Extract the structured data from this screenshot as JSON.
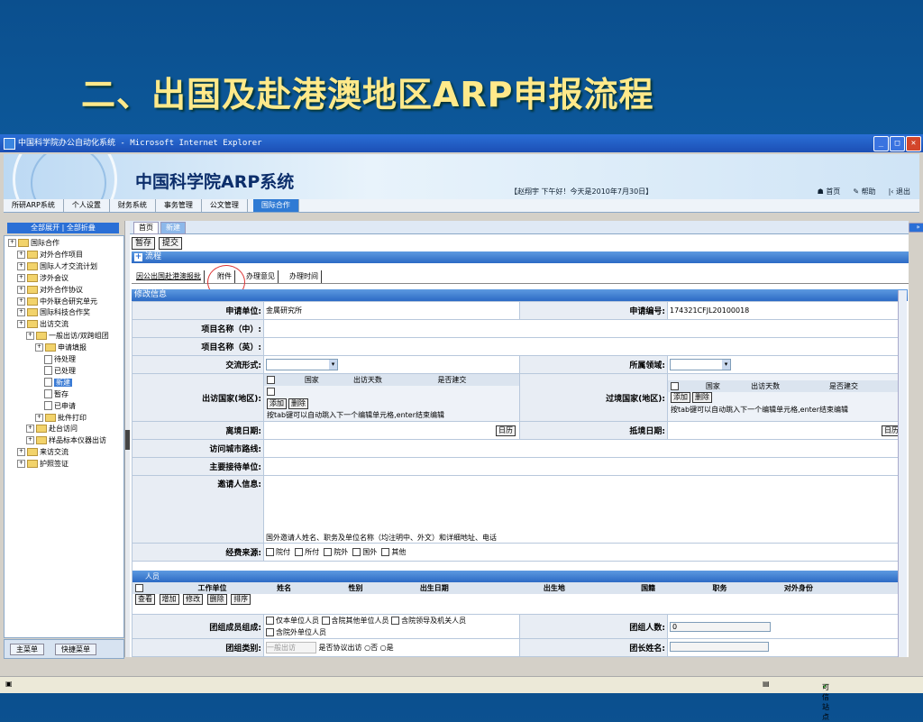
{
  "slide": {
    "title": "二、出国及赴港澳地区ARP申报流程"
  },
  "window": {
    "title": "中国科学院办公自动化系统 - Microsoft Internet Explorer"
  },
  "banner": {
    "system_name": "中国科学院ARP系统",
    "greeting": "【赵翔宇 下午好！今天是2010年7月30日】",
    "link_home": "首页",
    "link_help": "帮助",
    "link_exit": "退出"
  },
  "menubar": [
    "所研ARP系统",
    "个人设置",
    "财务系统",
    "事务管理",
    "公文管理",
    "国际合作"
  ],
  "left": {
    "expand_all": "全部展开",
    "collapse_all": "全部折叠",
    "tree": [
      {
        "label": "国际合作",
        "level": 0,
        "kind": "root"
      },
      {
        "label": "对外合作项目",
        "level": 1,
        "kind": "folder"
      },
      {
        "label": "国际人才交流计划",
        "level": 1,
        "kind": "folder"
      },
      {
        "label": "涉外会议",
        "level": 1,
        "kind": "folder"
      },
      {
        "label": "对外合作协议",
        "level": 1,
        "kind": "folder"
      },
      {
        "label": "中外联合研究单元",
        "level": 1,
        "kind": "folder"
      },
      {
        "label": "国际科技合作奖",
        "level": 1,
        "kind": "folder"
      },
      {
        "label": "出访交流",
        "level": 1,
        "kind": "folder"
      },
      {
        "label": "一般出访/双跨组团",
        "level": 2,
        "kind": "folder"
      },
      {
        "label": "申请填报",
        "level": 3,
        "kind": "folder"
      },
      {
        "label": "待处理",
        "level": 4,
        "kind": "page"
      },
      {
        "label": "已处理",
        "level": 4,
        "kind": "page"
      },
      {
        "label": "新建",
        "level": 4,
        "kind": "page",
        "selected": true
      },
      {
        "label": "暂存",
        "level": 4,
        "kind": "page"
      },
      {
        "label": "已申请",
        "level": 4,
        "kind": "page"
      },
      {
        "label": "批件打印",
        "level": 3,
        "kind": "folder"
      },
      {
        "label": "赴台访问",
        "level": 2,
        "kind": "folder"
      },
      {
        "label": "样品标本仪器出访",
        "level": 2,
        "kind": "folder"
      },
      {
        "label": "来访交流",
        "level": 1,
        "kind": "folder"
      },
      {
        "label": "护照签证",
        "level": 1,
        "kind": "folder"
      }
    ],
    "tab_main": "主菜单",
    "tab_quick": "快捷菜单"
  },
  "main": {
    "tab_home": "首页",
    "tab_new": "新建",
    "btn_save_draft": "暂存",
    "btn_submit": "提交",
    "flow": "流程",
    "subtabs": [
      "因公出国赴港澳报批",
      "附件",
      "办理意见",
      "办理时间"
    ],
    "form_title": "修改信息"
  },
  "form": {
    "applicant_unit_label": "申请单位:",
    "applicant_unit_value": "金属研究所",
    "application_no_label": "申请编号:",
    "application_no_value": "174321CFJL20100018",
    "project_cn_label": "项目名称（中）:",
    "project_en_label": "项目名称（英）:",
    "exchange_form_label": "交流形式:",
    "domain_label": "所属领域:",
    "visit_country_label": "出访国家(地区):",
    "transit_country_label": "过境国家(地区):",
    "country_cols": [
      "国家",
      "出访天数",
      "是否建交"
    ],
    "transit_cols": [
      "国家",
      "出访天数",
      "是否建交"
    ],
    "btn_add": "添加",
    "btn_delete": "删除",
    "tab_hint": "按tab键可以自动跳入下一个编辑单元格,enter结束编辑",
    "depart_date_label": "离境日期:",
    "arrive_date_label": "抵境日期:",
    "btn_calendar": "日历",
    "route_label": "访问城市路线:",
    "host_label": "主要接待单位:",
    "inviter_label": "邀请人信息:",
    "inviter_hint": "国外邀请人姓名、职务及单位名称（均注明中、外文）和详细地址、电话",
    "funding_label": "经费来源:",
    "funding_options": [
      "院付",
      "所付",
      "院外",
      "国外",
      "其他"
    ],
    "personnel_title": "人员",
    "personnel_cols": [
      "工作单位",
      "姓名",
      "性别",
      "出生日期",
      "出生地",
      "国籍",
      "职务",
      "对外身份"
    ],
    "personnel_buttons": [
      "查看",
      "增加",
      "修改",
      "删除",
      "排序"
    ],
    "members_label": "团组成员组成:",
    "members_options": [
      "仅本单位人员",
      "含院其他单位人员",
      "含院领导及机关人员",
      "含院外单位人员"
    ],
    "member_count_label": "团组人数:",
    "member_count_value": "0",
    "group_type_label": "团组类别:",
    "group_type_value": "一般出访",
    "agreement_text": "是否协议出访",
    "agreement_no": "否",
    "agreement_yes": "是",
    "leader_label": "团长姓名:"
  },
  "status": {
    "zone": "可信站点"
  }
}
